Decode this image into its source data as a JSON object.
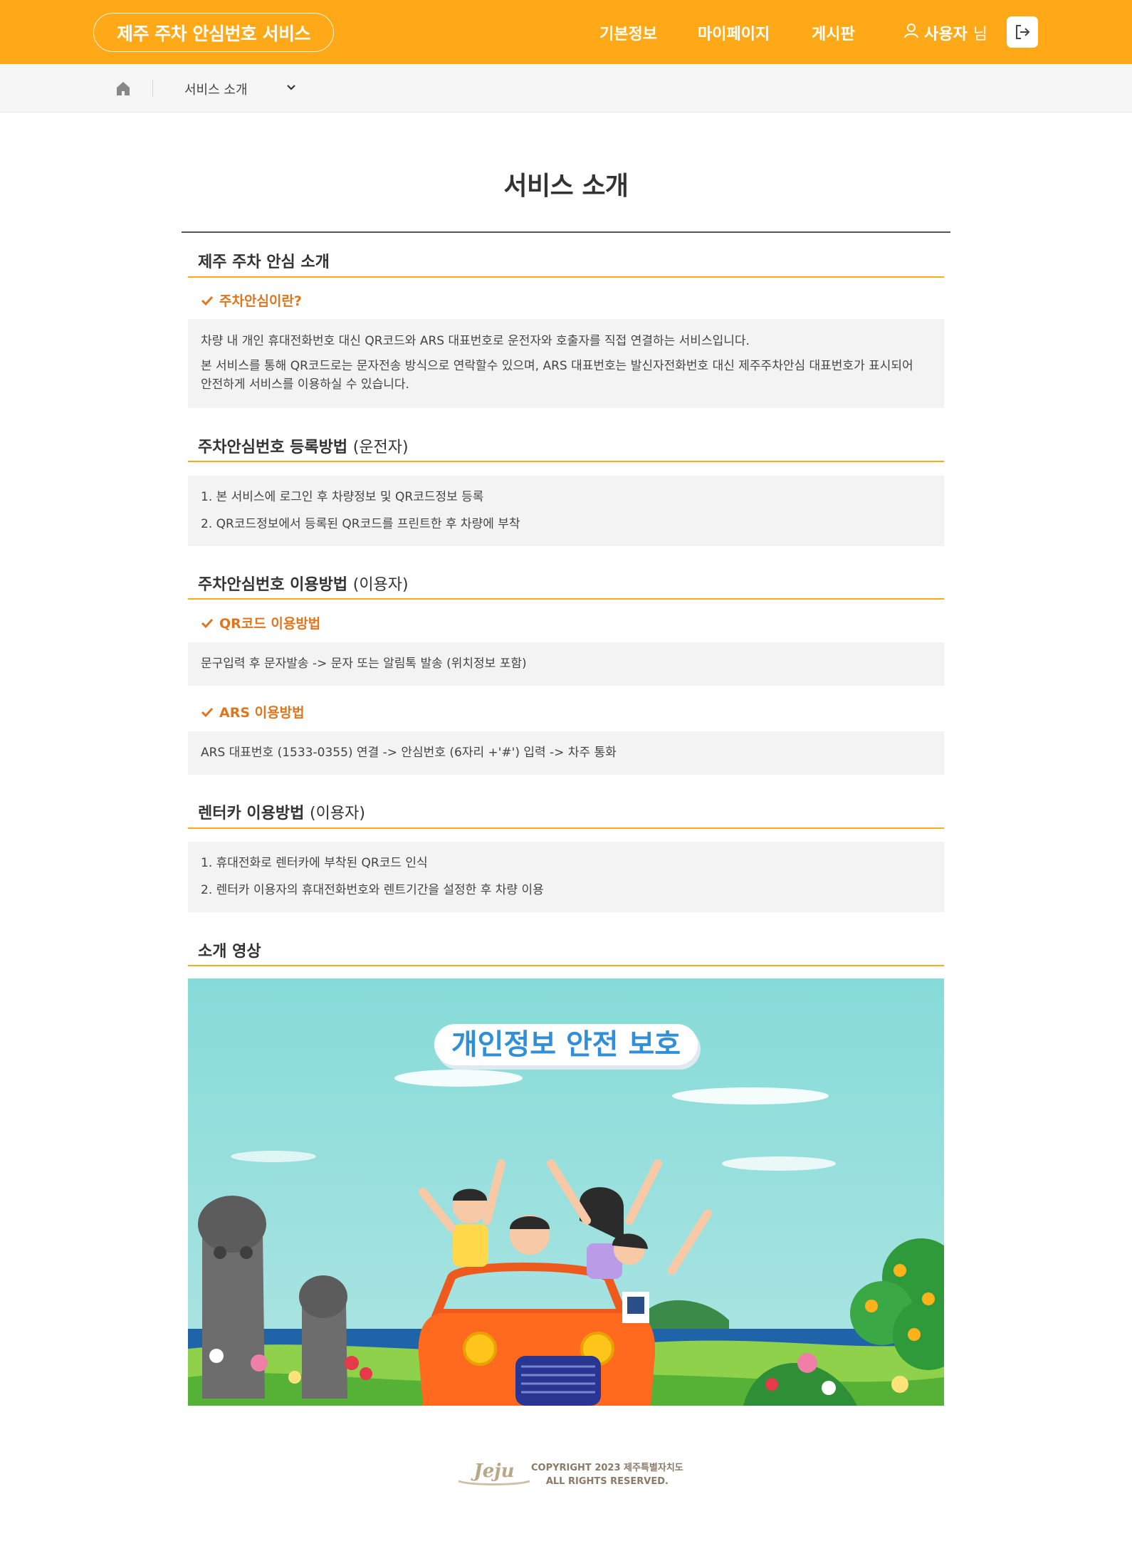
{
  "header": {
    "brand": "제주 주차 안심번호 서비스",
    "nav": [
      "기본정보",
      "마이페이지",
      "게시판"
    ],
    "user_name": "사용자",
    "user_suffix": "님"
  },
  "breadcrumb": {
    "current": "서비스 소개"
  },
  "page_title": "서비스 소개",
  "sections": {
    "intro": {
      "title": "제주 주차 안심 소개",
      "sub_title": "주차안심이란?",
      "lines": [
        "차량 내 개인 휴대전화번호 대신 QR코드와 ARS 대표번호로 운전자와 호출자를 직접 연결하는 서비스입니다.",
        "본 서비스를 통해 QR코드로는 문자전송 방식으로 연락할수 있으며, ARS 대표번호는 발신자전화번호 대신 제주주차안심 대표번호가 표시되어",
        "안전하게 서비스를 이용하실 수 있습니다."
      ]
    },
    "register": {
      "title": "주차안심번호 등록방법",
      "paren": "(운전자)",
      "lines": [
        "1. 본 서비스에 로그인 후 차량정보 및 QR코드정보 등록",
        "2. QR코드정보에서 등록된 QR코드를 프린트한 후 차량에 부착"
      ]
    },
    "usage": {
      "title": "주차안심번호 이용방법",
      "paren": "(이용자)",
      "qr_title": "QR코드 이용방법",
      "qr_text": "문구입력 후 문자발송 -> 문자 또는 알림톡 발송 (위치정보 포함)",
      "ars_title": "ARS 이용방법",
      "ars_text": "ARS 대표번호 (1533-0355) 연결 -> 안심번호 (6자리 +'#') 입력 -> 차주 통화"
    },
    "rentcar": {
      "title": "렌터카 이용방법",
      "paren": "(이용자)",
      "lines": [
        "1. 휴대전화로 렌터카에 부착된 QR코드 인식",
        "2. 렌터카 이용자의 휴대전화번호와 렌트기간을 설정한 후 차량 이용"
      ]
    },
    "video": {
      "title": "소개 영상",
      "banner": "개인정보 안전 보호"
    }
  },
  "footer": {
    "logo_text": "Jeju",
    "copyright_line1": "COPYRIGHT 2023 제주특별자치도",
    "copyright_line2": "ALL RIGHTS RESERVED."
  },
  "colors": {
    "accent": "#ffa818",
    "sub_title": "#e0751c",
    "box_bg": "#f3f3f3"
  }
}
